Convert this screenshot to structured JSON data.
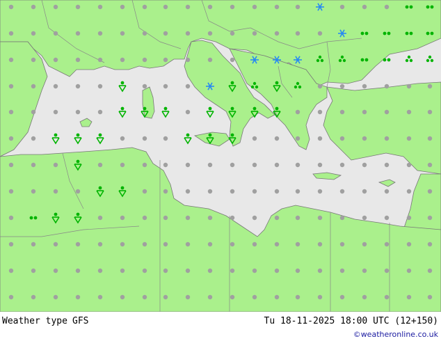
{
  "title": "Weather type",
  "model": "GFS",
  "valid_time": "Tu 18-11-2025 18:00 UTC (12+150)",
  "credit": "©weatheronline.co.uk",
  "colors": {
    "land": "#aaf08c",
    "sea": "#e8e8e8",
    "border": "#888888",
    "coast": "#777777",
    "dry_symbol": "#a0a0a0",
    "rain_symbol": "#00b400",
    "snow_symbol": "#2a8cf0"
  },
  "legend_symbols": [
    "dry-dot",
    "rain-shower",
    "snow-shower",
    "drizzle"
  ]
}
